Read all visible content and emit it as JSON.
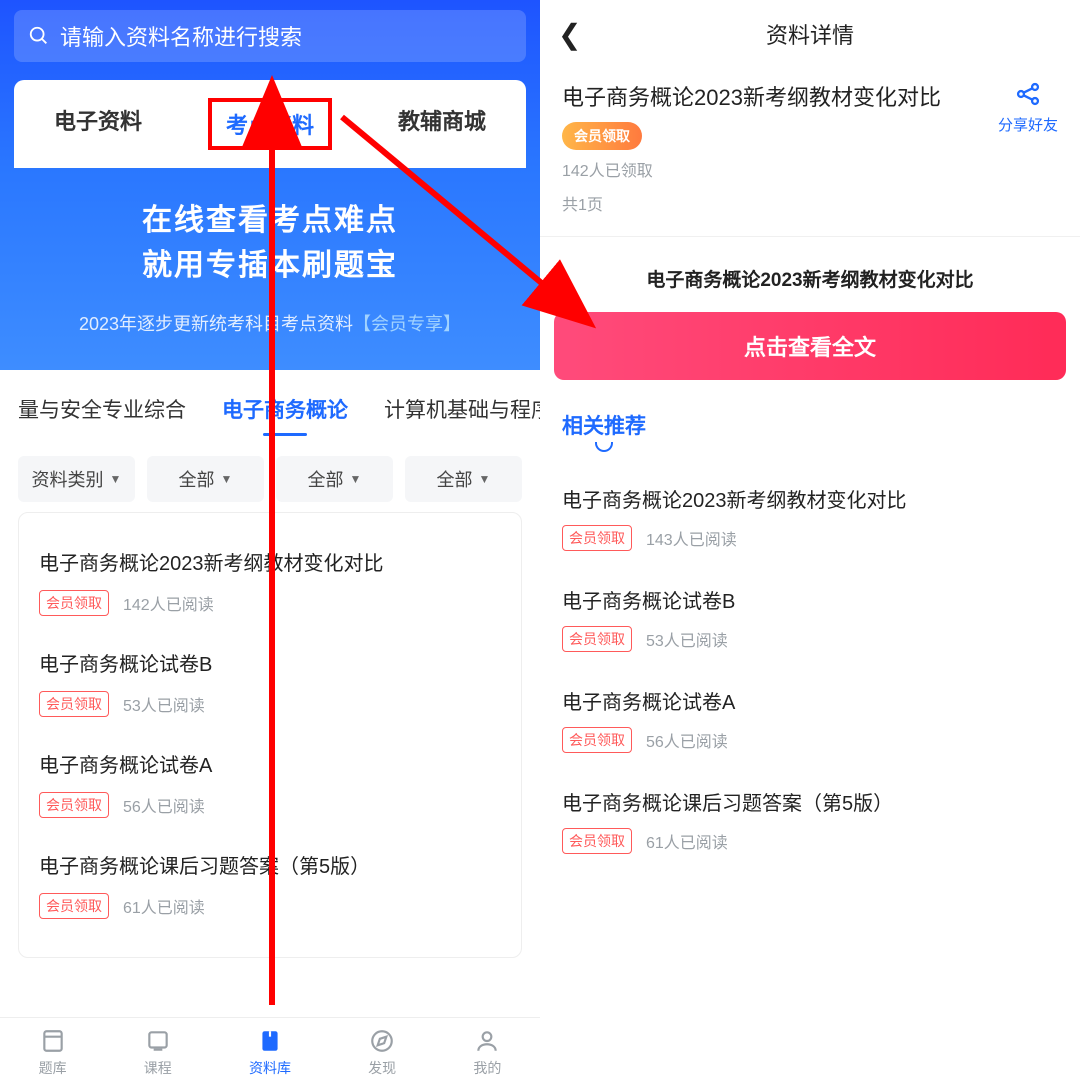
{
  "left": {
    "search_placeholder": "请输入资料名称进行搜索",
    "top_tabs": [
      "电子资料",
      "考点资料",
      "教辅商城"
    ],
    "active_top_tab": 1,
    "banner": {
      "line1": "在线查看考点难点",
      "line2": "就用专插本刷题宝",
      "sub_prefix": "2023年逐步更新统考科目考点资料",
      "sub_bracket": "【会员专享】"
    },
    "subject_tabs": [
      "量与安全专业综合",
      "电子商务概论",
      "计算机基础与程序"
    ],
    "active_subject_tab": 1,
    "filters": [
      "资料类别",
      "全部",
      "全部",
      "全部"
    ],
    "badge_label": "会员领取",
    "list": [
      {
        "title": "电子商务概论2023新考纲教材变化对比",
        "reads": "142人已阅读"
      },
      {
        "title": "电子商务概论试卷B",
        "reads": "53人已阅读"
      },
      {
        "title": "电子商务概论试卷A",
        "reads": "56人已阅读"
      },
      {
        "title": "电子商务概论课后习题答案（第5版）",
        "reads": "61人已阅读"
      }
    ],
    "nav": [
      "题库",
      "课程",
      "资料库",
      "发现",
      "我的"
    ],
    "active_nav": 2
  },
  "right": {
    "header_title": "资料详情",
    "detail": {
      "title": "电子商务概论2023新考纲教材变化对比",
      "pill": "会员领取",
      "received": "142人已领取",
      "pages": "共1页",
      "share_label": "分享好友"
    },
    "preview_title": "电子商务概论2023新考纲教材变化对比",
    "view_button": "点击查看全文",
    "related_title": "相关推荐",
    "badge_label": "会员领取",
    "related": [
      {
        "title": "电子商务概论2023新考纲教材变化对比",
        "reads": "143人已阅读"
      },
      {
        "title": "电子商务概论试卷B",
        "reads": "53人已阅读"
      },
      {
        "title": "电子商务概论试卷A",
        "reads": "56人已阅读"
      },
      {
        "title": "电子商务概论课后习题答案（第5版）",
        "reads": "61人已阅读"
      }
    ]
  }
}
